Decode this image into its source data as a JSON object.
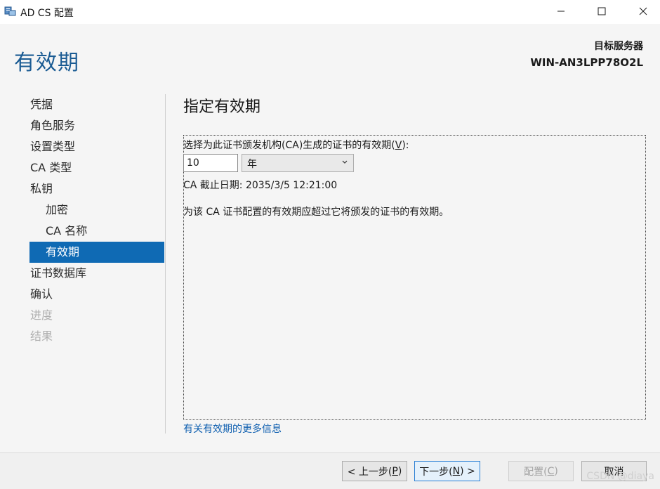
{
  "window": {
    "title": "AD CS 配置",
    "icon": "server-app-icon",
    "controls": [
      "minimize-icon",
      "maximize-icon",
      "close-icon"
    ]
  },
  "header": {
    "page_title": "有效期",
    "server_label": "目标服务器",
    "server_name": "WIN-AN3LPP78O2L"
  },
  "nav": {
    "items": [
      {
        "label": "凭据",
        "state": "normal",
        "level": 0
      },
      {
        "label": "角色服务",
        "state": "normal",
        "level": 0
      },
      {
        "label": "设置类型",
        "state": "normal",
        "level": 0
      },
      {
        "label": "CA 类型",
        "state": "normal",
        "level": 0
      },
      {
        "label": "私钥",
        "state": "normal",
        "level": 0
      },
      {
        "label": "加密",
        "state": "normal",
        "level": 1
      },
      {
        "label": "CA 名称",
        "state": "normal",
        "level": 1
      },
      {
        "label": "有效期",
        "state": "active",
        "level": 1
      },
      {
        "label": "证书数据库",
        "state": "normal",
        "level": 0
      },
      {
        "label": "确认",
        "state": "normal",
        "level": 0
      },
      {
        "label": "进度",
        "state": "disabled",
        "level": 0
      },
      {
        "label": "结果",
        "state": "disabled",
        "level": 0
      }
    ]
  },
  "main": {
    "section_title": "指定有效期",
    "select_label_prefix": "选择为此证书颁发机构(CA)生成的证书的有效期(",
    "select_label_key": "V",
    "select_label_suffix": "):",
    "period_value": "10",
    "period_unit": "年",
    "expiry_text": "CA 截止日期: 2035/3/5 12:21:00",
    "note_text": "为该 CA 证书配置的有效期应超过它将颁发的证书的有效期。",
    "more_info_link": "有关有效期的更多信息"
  },
  "footer": {
    "prev": {
      "prefix": "< 上一步(",
      "key": "P",
      "suffix": ")"
    },
    "next": {
      "prefix": "下一步(",
      "key": "N",
      "suffix": ") >"
    },
    "configure": {
      "prefix": "配置(",
      "key": "C",
      "suffix": ")"
    },
    "cancel": "取消",
    "watermark": "CSDN @diaya"
  },
  "colors": {
    "accent": "#0f6ab4",
    "title": "#1a5b93",
    "link": "#1060b0",
    "disabled": "#b0b0b0"
  }
}
